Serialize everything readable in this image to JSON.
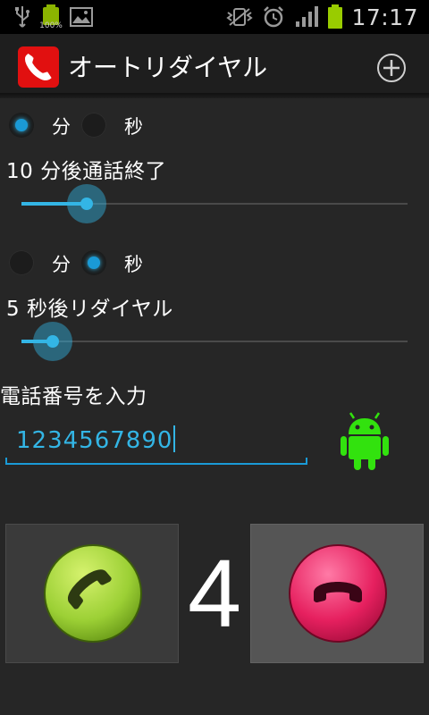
{
  "status_bar": {
    "time": "17:17",
    "battery_small_text": "100%",
    "icons": [
      "usb-icon",
      "battery-full-icon",
      "picture-icon",
      "vibrate-icon",
      "alarm-icon",
      "signal-icon",
      "battery-icon"
    ]
  },
  "action_bar": {
    "title": "オートリダイヤル",
    "app_icon": "phone-app-icon",
    "add_icon": "add-circle-icon"
  },
  "call_end_setting": {
    "unit_options": [
      {
        "label": "分",
        "selected": true
      },
      {
        "label": "秒",
        "selected": false
      }
    ],
    "text": "10 分後通話終了",
    "value": 10,
    "slider_fraction": 0.17
  },
  "redial_setting": {
    "unit_options": [
      {
        "label": "分",
        "selected": false
      },
      {
        "label": "秒",
        "selected": true
      }
    ],
    "text": "5 秒後リダイヤル",
    "value": 5,
    "slider_fraction": 0.08
  },
  "phone": {
    "label": "電話番号を入力",
    "value": "1234567890",
    "contact_icon": "android-icon"
  },
  "controls": {
    "countdown": "4",
    "start_icon": "call-start-icon",
    "end_icon": "call-end-icon"
  },
  "colors": {
    "accent": "#33b5e5",
    "background": "#262626",
    "start_button": "#9cd035",
    "end_button": "#e6205f",
    "android": "#32e20e"
  }
}
